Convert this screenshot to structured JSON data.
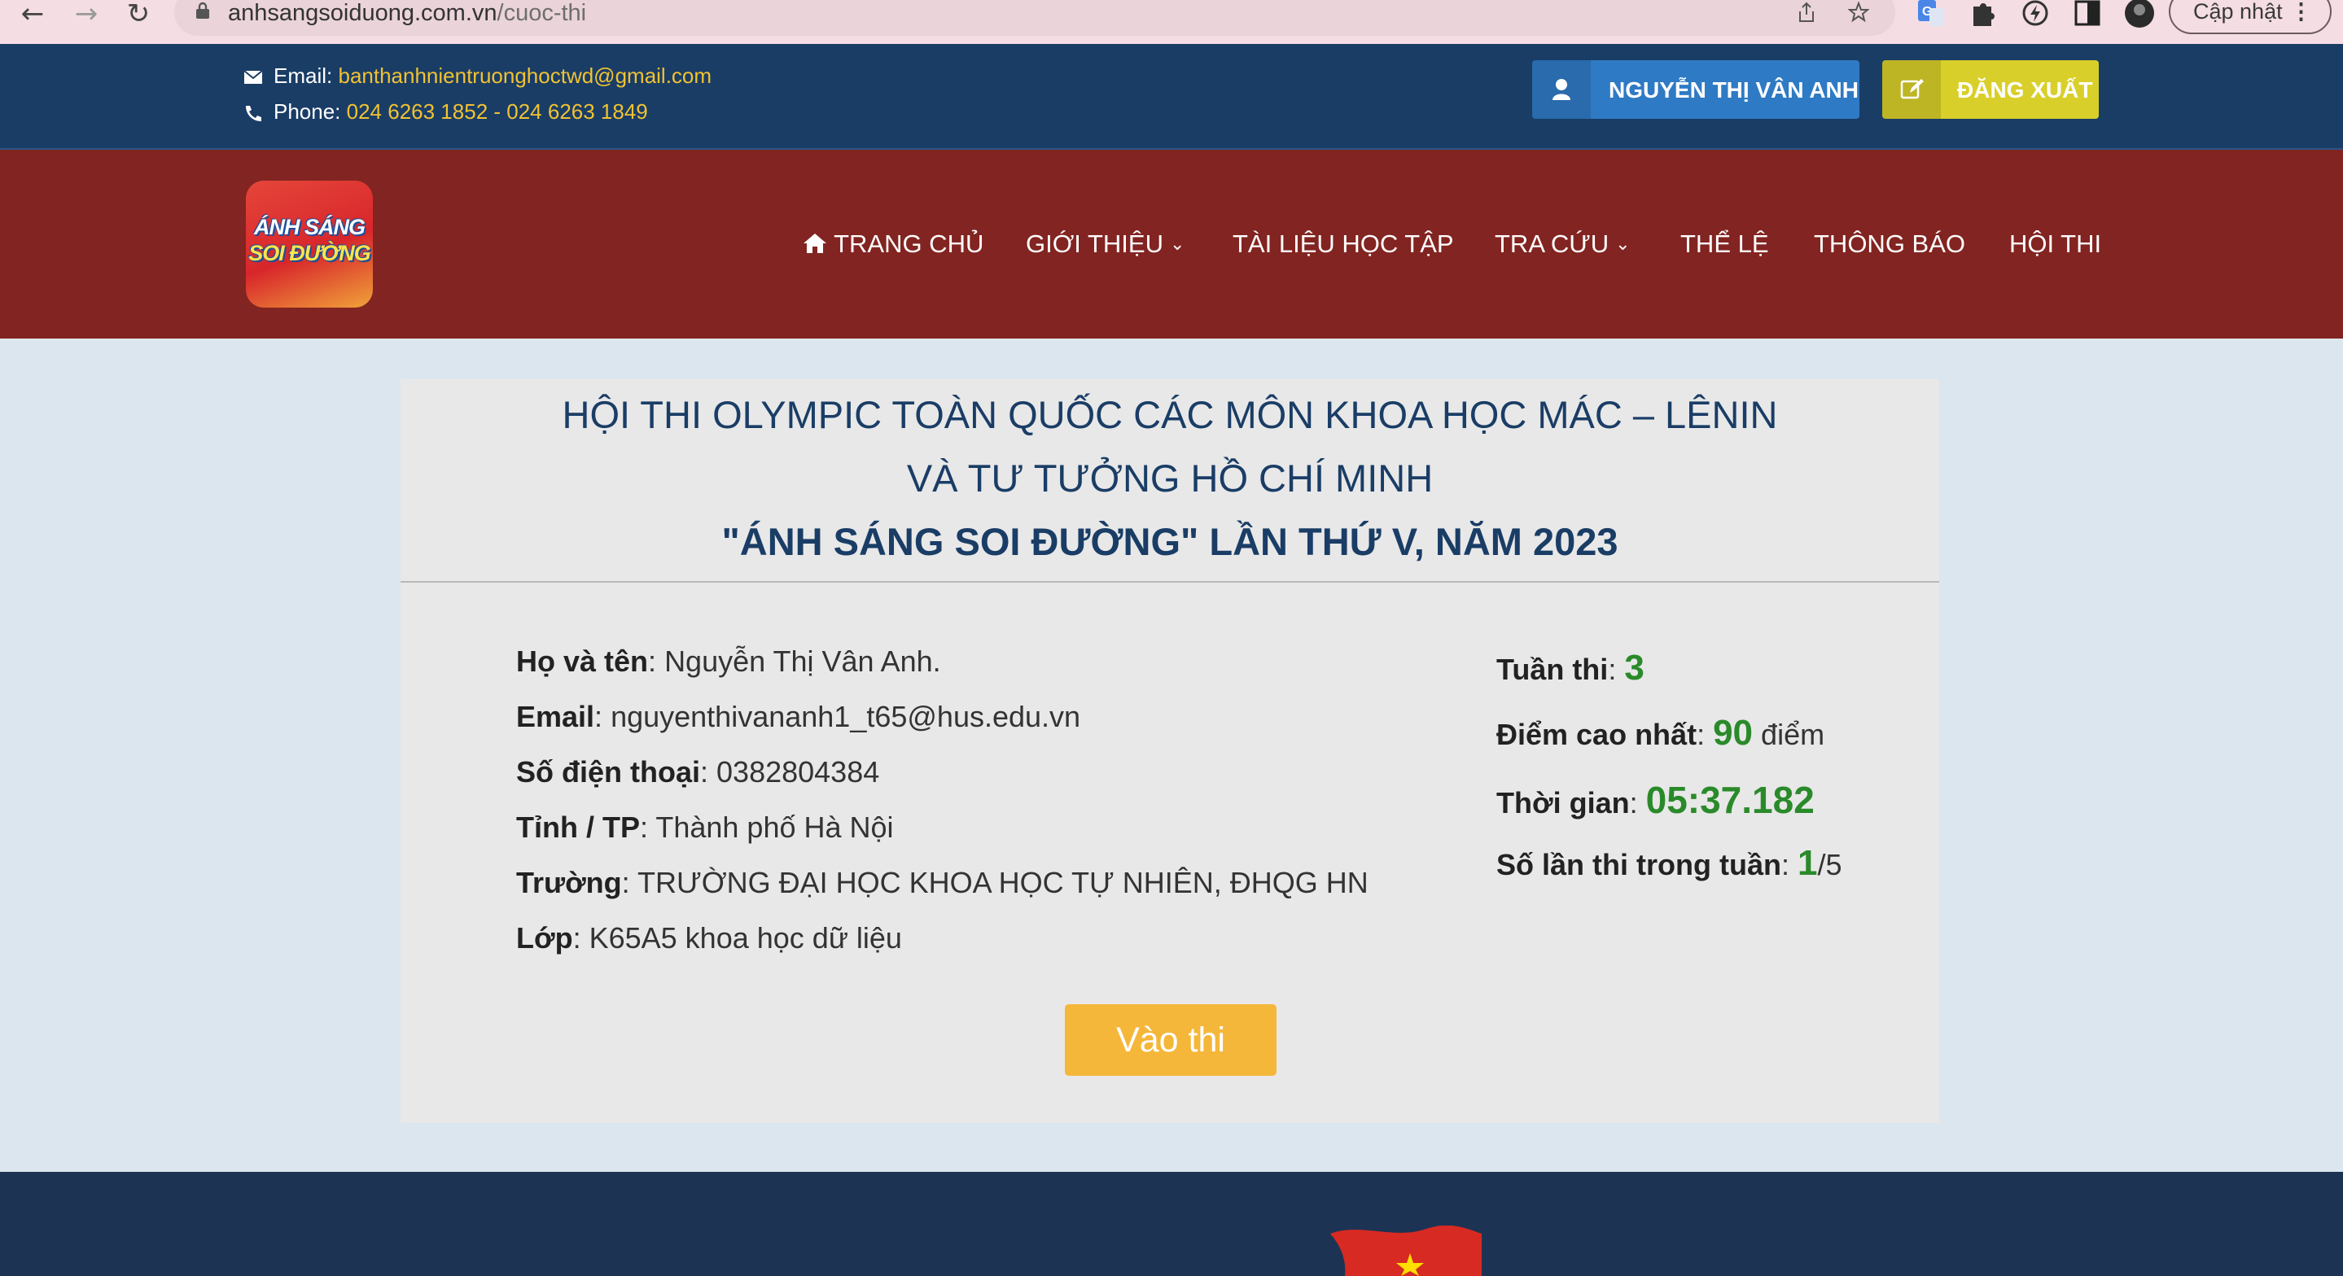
{
  "browser": {
    "url_host": "anhsangsoiduong.com.vn",
    "url_path": "/cuoc-thi",
    "update_label": "Cập nhật"
  },
  "contact": {
    "email_label": "Email:",
    "email_value": "banthanhnientruonghoctwd@gmail.com",
    "phone_label": "Phone:",
    "phone_value": "024 6263 1852 - 024 6263 1849"
  },
  "account": {
    "user_name": "NGUYỄN THỊ VÂN ANH",
    "logout_label": "ĐĂNG XUẤT"
  },
  "logo": {
    "line1": "ÁNH SÁNG",
    "line2": "SOI ĐƯỜNG"
  },
  "nav": {
    "home": "TRANG CHỦ",
    "intro": "GIỚI THIỆU",
    "docs": "TÀI LIỆU HỌC TẬP",
    "lookup": "TRA CỨU",
    "rules": "THỂ LỆ",
    "news": "THÔNG BÁO",
    "contest": "HỘI THI"
  },
  "contest": {
    "title_line1": "HỘI THI OLYMPIC TOÀN QUỐC CÁC MÔN KHOA HỌC MÁC – LÊNIN",
    "title_line2": "VÀ TƯ TƯỞNG HỒ CHÍ MINH",
    "title_line3": "\"ÁNH SÁNG SOI ĐƯỜNG\" LẦN THỨ V, NĂM 2023"
  },
  "profile": {
    "name_label": "Họ và tên",
    "name_value": "Nguyễn Thị Vân Anh.",
    "email_label": "Email",
    "email_value": "nguyenthivananh1_t65@hus.edu.vn",
    "phone_label": "Số điện thoại",
    "phone_value": "0382804384",
    "province_label": "Tỉnh / TP",
    "province_value": "Thành phố Hà Nội",
    "school_label": "Trường",
    "school_value": "TRƯỜNG ĐẠI HỌC KHOA HỌC TỰ NHIÊN, ĐHQG HN",
    "class_label": "Lớp",
    "class_value": "K65A5 khoa học dữ liệu"
  },
  "stats": {
    "week_label": "Tuần thi",
    "week_value": "3",
    "best_label": "Điểm cao nhất",
    "best_value": "90",
    "best_unit": "điểm",
    "time_label": "Thời gian",
    "time_value": "05:37.182",
    "attempts_label": "Số lần thi trong tuần",
    "attempts_value": "1",
    "attempts_total": "/5"
  },
  "actions": {
    "enter_label": "Vào thi"
  },
  "colors": {
    "topbar": "#1a3d66",
    "mainnav": "#822421",
    "accent_yellow": "#f1c232",
    "button_orange": "#f5b73a",
    "stat_green": "#2a8a2a"
  }
}
